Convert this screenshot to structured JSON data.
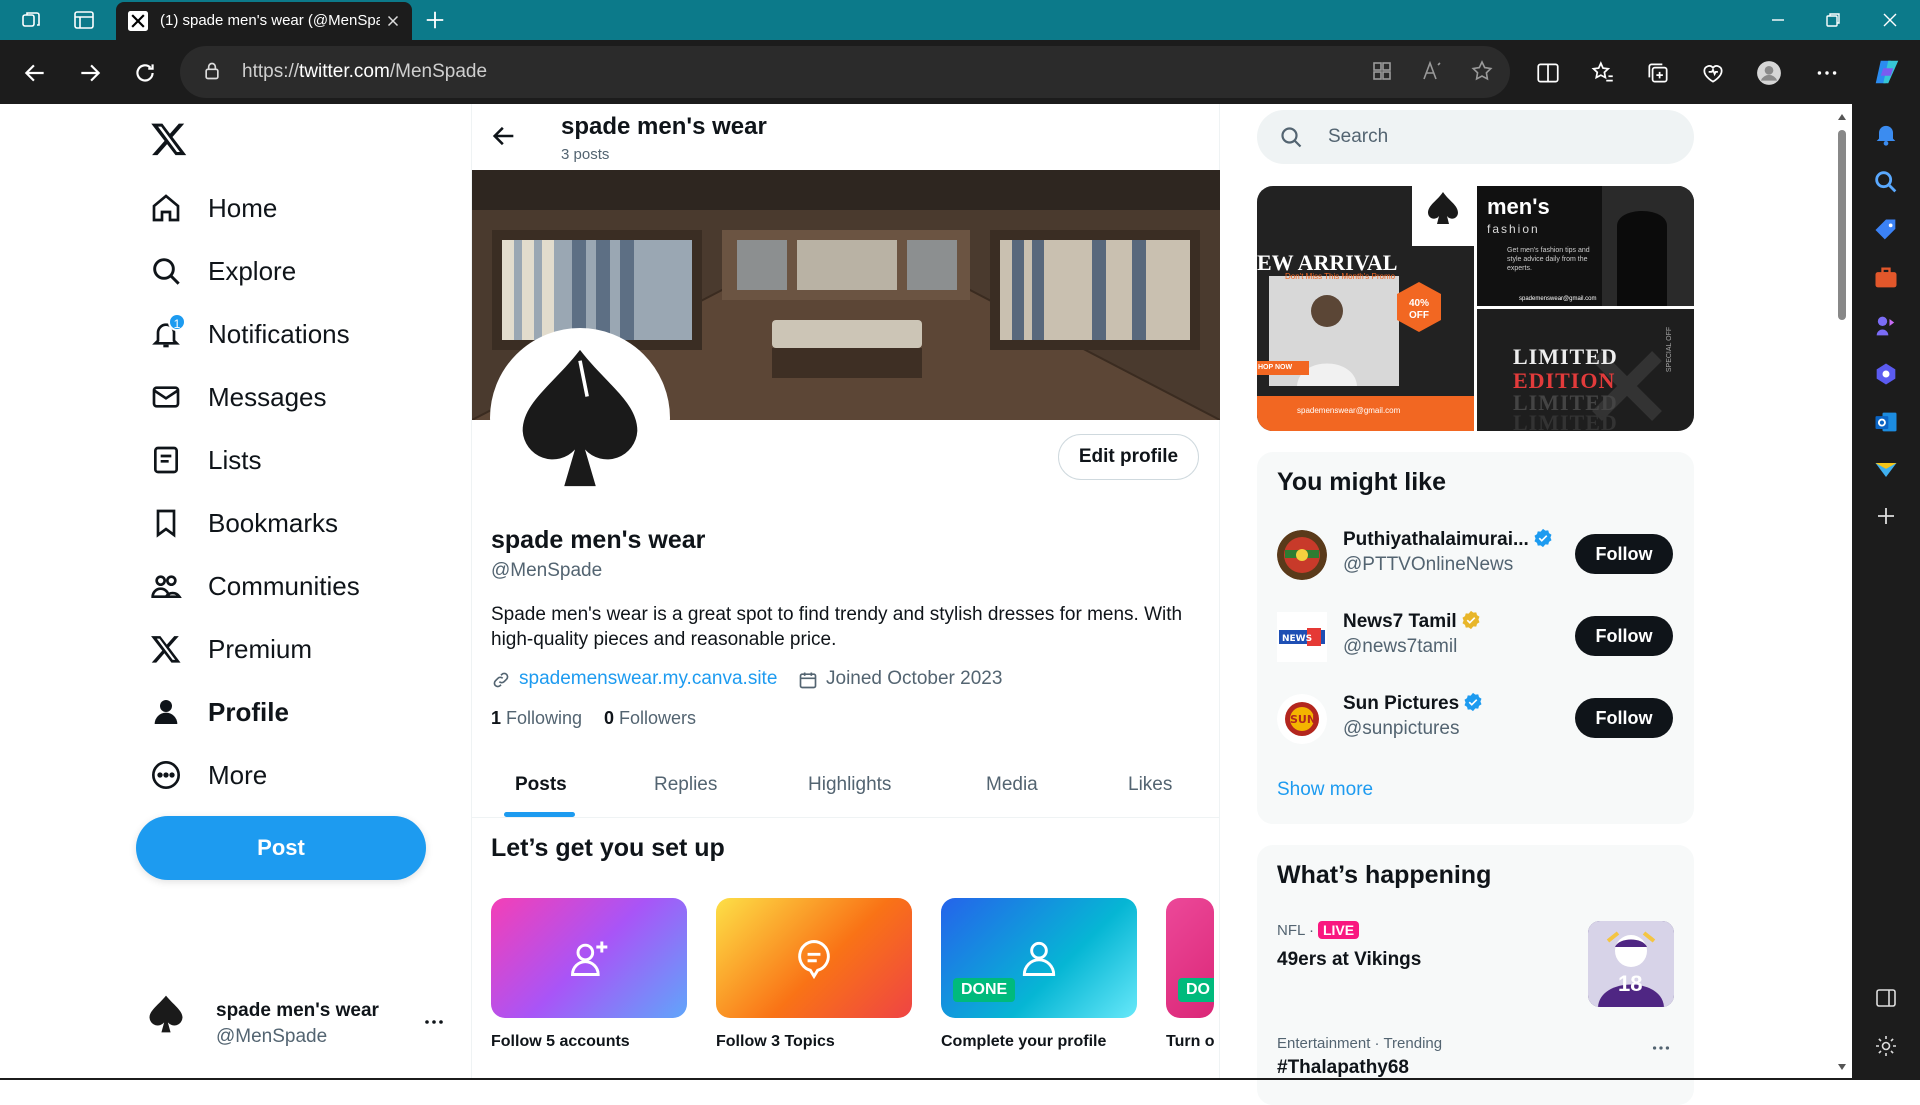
{
  "browser": {
    "tab_title": "(1) spade men's wear (@MenSpade) / X",
    "url_prefix": "https://",
    "url_host": "twitter.com",
    "url_path": "/MenSpade"
  },
  "nav": {
    "items": [
      {
        "label": "Home",
        "icon": "home-icon"
      },
      {
        "label": "Explore",
        "icon": "search-icon"
      },
      {
        "label": "Notifications",
        "icon": "bell-icon",
        "badge": "1"
      },
      {
        "label": "Messages",
        "icon": "envelope-icon"
      },
      {
        "label": "Lists",
        "icon": "list-icon"
      },
      {
        "label": "Bookmarks",
        "icon": "bookmark-icon"
      },
      {
        "label": "Communities",
        "icon": "people-icon"
      },
      {
        "label": "Premium",
        "icon": "x-logo-icon"
      },
      {
        "label": "Profile",
        "icon": "person-icon"
      },
      {
        "label": "More",
        "icon": "more-circle-icon"
      }
    ],
    "post_label": "Post",
    "account": {
      "name": "spade men's wear",
      "handle": "@MenSpade"
    }
  },
  "profile": {
    "header_name": "spade men's wear",
    "header_posts": "3 posts",
    "edit_label": "Edit profile",
    "name": "spade men's wear",
    "handle": "@MenSpade",
    "bio": "Spade men's wear is a great spot to find trendy and stylish dresses for mens. With high-quality pieces and reasonable price.",
    "link": "spademenswear.my.canva.site",
    "joined": "Joined October 2023",
    "following_count": "1",
    "following_label": "Following",
    "followers_count": "0",
    "followers_label": "Followers",
    "tabs": [
      "Posts",
      "Replies",
      "Highlights",
      "Media",
      "Likes"
    ]
  },
  "setup": {
    "title": "Let’s get you set up",
    "cards": [
      {
        "label": "Follow 5 accounts",
        "done": ""
      },
      {
        "label": "Follow 3 Topics",
        "done": ""
      },
      {
        "label": "Complete your profile",
        "done": "DONE"
      },
      {
        "label": "Turn o",
        "done": "DO"
      }
    ]
  },
  "search": {
    "placeholder": "Search"
  },
  "promo": {
    "new_arrival": "EW ARRIVAL",
    "promo_sub": "Don't Miss This Month's Promo",
    "discount": "40% OFF",
    "shop_now": "HOP NOW",
    "email": "spademenswear@gmail.com",
    "mens": "men's",
    "fashion": "fashion",
    "fashion_desc": "Get men's fashion tips and style advice daily from the experts.",
    "email2": "spademenswear@gmail.com",
    "limited": "LIMITED",
    "edition": "EDITION",
    "limited2": "LIMITED",
    "limited3": "LIMITED",
    "special": "SPECIAL OFF"
  },
  "who_to_follow": {
    "title": "You might like",
    "accounts": [
      {
        "name": "Puthiyathalaimurai...",
        "handle": "@PTTVOnlineNews",
        "verified": "blue"
      },
      {
        "name": "News7 Tamil",
        "handle": "@news7tamil",
        "verified": "gold"
      },
      {
        "name": "Sun Pictures",
        "handle": "@sunpictures",
        "verified": "blue"
      }
    ],
    "follow_label": "Follow",
    "show_more": "Show more"
  },
  "happening": {
    "title": "What’s happening",
    "trend1_ctx": "NFL ·",
    "trend1_live": "LIVE",
    "trend1_name": "49ers at Vikings",
    "trend1_jersey": "18",
    "trend2_ctx": "Entertainment · Trending",
    "trend2_name": "#Thalapathy68"
  },
  "colors": {
    "accent": "#1d9bf0",
    "done": "#00ba7c",
    "live": "#f91880",
    "tabbar": "#0c7a8a"
  }
}
